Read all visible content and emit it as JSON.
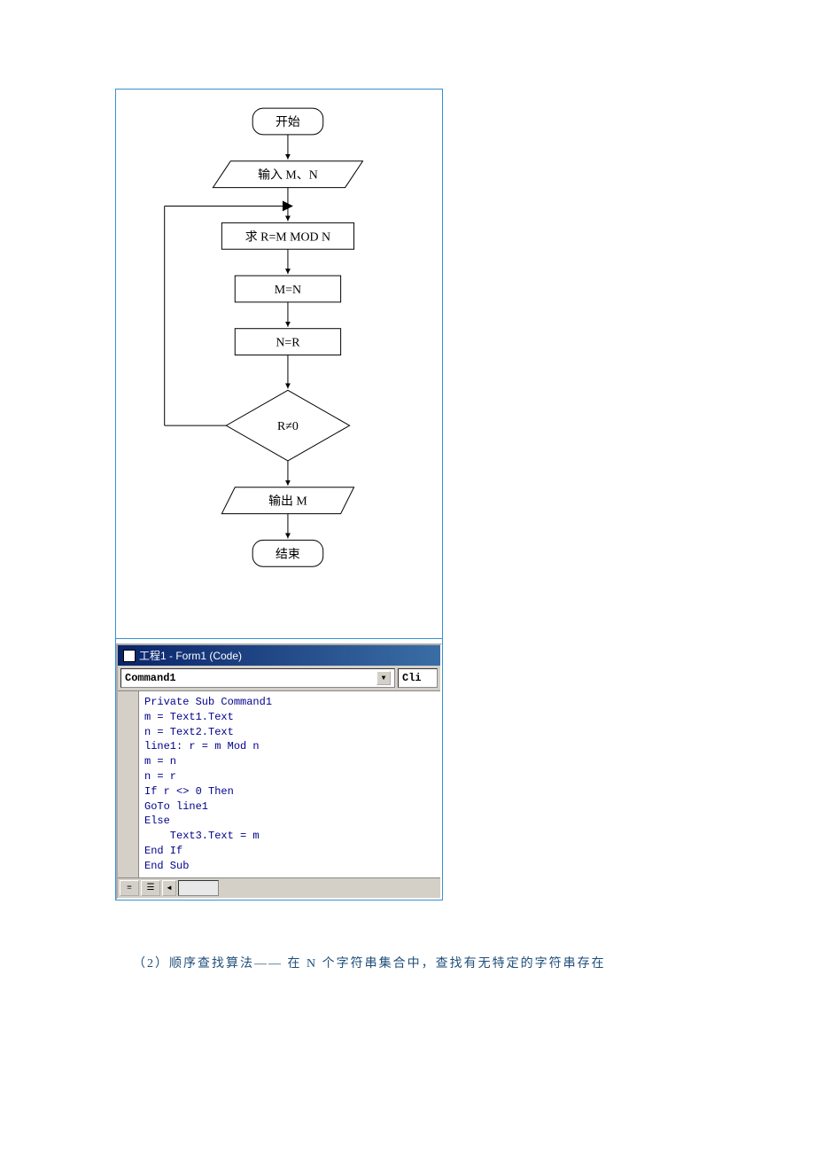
{
  "flowchart": {
    "start": "开始",
    "input": "输入 M、N",
    "proc1": "求 R=M MOD N",
    "proc2": "M=N",
    "proc3": "N=R",
    "decision": "R≠0",
    "output": "输出 M",
    "end": "结束"
  },
  "codewin": {
    "title": "工程1 - Form1 (Code)",
    "dropdown1": "Command1",
    "dropdown2": "Cli",
    "code": "Private Sub Command1\nm = Text1.Text\nn = Text2.Text\nline1: r = m Mod n\nm = n\nn = r\nIf r <> 0 Then\nGoTo line1\nElse\n    Text3.Text = m\nEnd If\nEnd Sub"
  },
  "caption": "（2）顺序查找算法——  在 N 个字符串集合中，查找有无特定的字符串存在"
}
